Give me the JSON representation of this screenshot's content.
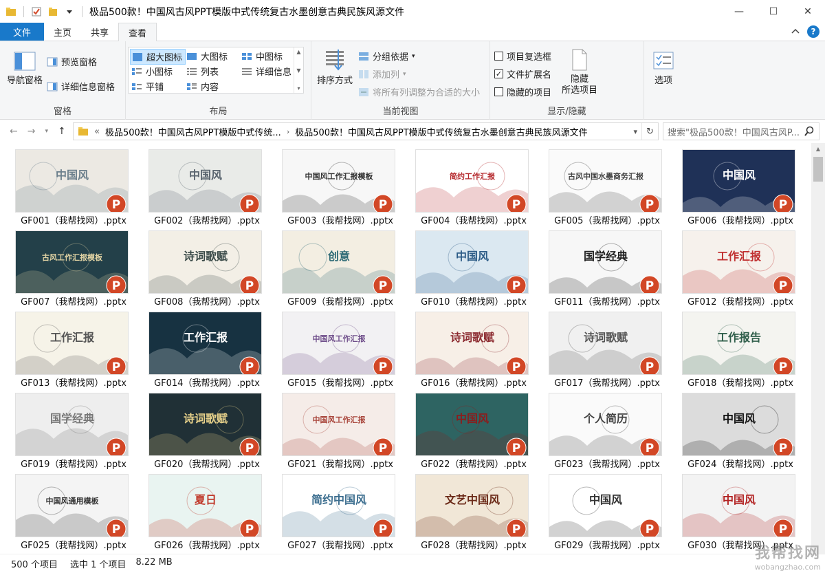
{
  "window": {
    "title": "极品500款！中国风古风PPT模版中式传统复古水墨创意古典民族风源文件",
    "controls": [
      "—",
      "☐",
      "✕"
    ]
  },
  "tabs": [
    {
      "label": "文件"
    },
    {
      "label": "主页"
    },
    {
      "label": "共享"
    },
    {
      "label": "查看"
    }
  ],
  "ribbon": {
    "panes": {
      "label": "窗格",
      "nav_pane": "导航窗格",
      "preview_pane": "预览窗格",
      "details_pane": "详细信息窗格"
    },
    "layout": {
      "label": "布局",
      "options": [
        "超大图标",
        "大图标",
        "中图标",
        "小图标",
        "列表",
        "详细信息",
        "平铺",
        "内容"
      ],
      "selected": "超大图标"
    },
    "current_view": {
      "label": "当前视图",
      "sort_by": "排序方式",
      "group_by": "分组依据",
      "add_column": "添加列",
      "fit_columns": "将所有列调整为合适的大小"
    },
    "show_hide": {
      "label": "显示/隐藏",
      "item_checkboxes": {
        "label": "项目复选框",
        "checked": false
      },
      "file_extensions": {
        "label": "文件扩展名",
        "checked": true
      },
      "hidden_items": {
        "label": "隐藏的项目",
        "checked": false
      },
      "hide_selected_line1": "隐藏",
      "hide_selected_line2": "所选项目"
    },
    "options": "选项"
  },
  "address": {
    "crumb_overflow": "«",
    "crumb1": "极品500款！中国风古风PPT模版中式传统...",
    "crumb2": "极品500款！中国风古风PPT模版中式传统复古水墨创意古典民族风源文件",
    "search_placeholder": "搜索\"极品500款！中国风古风P..."
  },
  "files": [
    {
      "name": "GF001（我帮找网）.pptx",
      "bg": "#ece9e3",
      "accent": "#6b7f8c",
      "title": "中国风"
    },
    {
      "name": "GF002（我帮找网）.pptx",
      "bg": "#e9ebe8",
      "accent": "#5b6670",
      "title": "中国风"
    },
    {
      "name": "GF003（我帮找网）.pptx",
      "bg": "#f7f7f7",
      "accent": "#333333",
      "title": "中国风工作汇报模板"
    },
    {
      "name": "GF004（我帮找网）.pptx",
      "bg": "#ffffff",
      "accent": "#b5282c",
      "title": "简约工作汇报"
    },
    {
      "name": "GF005（我帮找网）.pptx",
      "bg": "#fafafa",
      "accent": "#444444",
      "title": "古风中国水墨商务汇报"
    },
    {
      "name": "GF006（我帮找网）.pptx",
      "bg": "#1f3157",
      "accent": "#ffffff",
      "title": "中国风"
    },
    {
      "name": "GF007（我帮找网）.pptx",
      "bg": "#234049",
      "accent": "#e0d2a3",
      "title": "古风工作汇报模板"
    },
    {
      "name": "GF008（我帮找网）.pptx",
      "bg": "#f3efe6",
      "accent": "#3a4a48",
      "title": "诗词歌赋"
    },
    {
      "name": "GF009（我帮找网）.pptx",
      "bg": "#f3eee2",
      "accent": "#2f6b76",
      "title": "创意"
    },
    {
      "name": "GF010（我帮找网）.pptx",
      "bg": "#dbe8f1",
      "accent": "#2e5d88",
      "title": "中国风"
    },
    {
      "name": "GF011（我帮找网）.pptx",
      "bg": "#f7f7f7",
      "accent": "#222222",
      "title": "国学经典"
    },
    {
      "name": "GF012（我帮找网）.pptx",
      "bg": "#f6f1ec",
      "accent": "#c03030",
      "title": "工作汇报"
    },
    {
      "name": "GF013（我帮找网）.pptx",
      "bg": "#f6f3e8",
      "accent": "#555555",
      "title": "工作汇报"
    },
    {
      "name": "GF014（我帮找网）.pptx",
      "bg": "#173241",
      "accent": "#ffffff",
      "title": "工作汇报"
    },
    {
      "name": "GF015（我帮找网）.pptx",
      "bg": "#f2f1f3",
      "accent": "#6f4e8a",
      "title": "中国风工作汇报"
    },
    {
      "name": "GF016（我帮找网）.pptx",
      "bg": "#f7efe7",
      "accent": "#8c2a30",
      "title": "诗词歌赋"
    },
    {
      "name": "GF017（我帮找网）.pptx",
      "bg": "#f0f0f0",
      "accent": "#555555",
      "title": "诗词歌赋"
    },
    {
      "name": "GF018（我帮找网）.pptx",
      "bg": "#f4f4f0",
      "accent": "#2f5e4a",
      "title": "工作报告"
    },
    {
      "name": "GF019（我帮找网）.pptx",
      "bg": "#eeeeee",
      "accent": "#777777",
      "title": "国学经典"
    },
    {
      "name": "GF020（我帮找网）.pptx",
      "bg": "#203036",
      "accent": "#e6d08a",
      "title": "诗词歌赋"
    },
    {
      "name": "GF021（我帮找网）.pptx",
      "bg": "#f5ece8",
      "accent": "#a8443a",
      "title": "中国风工作汇报"
    },
    {
      "name": "GF022（我帮找网）.pptx",
      "bg": "#2e6462",
      "accent": "#8c1c1c",
      "title": "中国风"
    },
    {
      "name": "GF023（我帮找网）.pptx",
      "bg": "#fafafa",
      "accent": "#444444",
      "title": "个人简历"
    },
    {
      "name": "GF024（我帮找网）.pptx",
      "bg": "#dcdcdc",
      "accent": "#111111",
      "title": "中国风"
    },
    {
      "name": "GF025（我帮找网）.pptx",
      "bg": "#f4f4f4",
      "accent": "#333333",
      "title": "中国风通用模板"
    },
    {
      "name": "GF026（我帮找网）.pptx",
      "bg": "#e9f4f1",
      "accent": "#c0392b",
      "title": "夏日"
    },
    {
      "name": "GF027（我帮找网）.pptx",
      "bg": "#ffffff",
      "accent": "#3c6e8f",
      "title": "简约中国风"
    },
    {
      "name": "GF028（我帮找网）.pptx",
      "bg": "#f1e7d7",
      "accent": "#6b2a18",
      "title": "文艺中国风"
    },
    {
      "name": "GF029（我帮找网）.pptx",
      "bg": "#ffffff",
      "accent": "#333333",
      "title": "中国风"
    },
    {
      "name": "GF030（我帮找网）.pptx",
      "bg": "#f3f3f3",
      "accent": "#b22222",
      "title": "中国风"
    }
  ],
  "status": {
    "count": "500 个项目",
    "selected": "选中 1 个项目",
    "size": "8.22 MB"
  },
  "watermark": {
    "line1": "我帮找网",
    "line2": "wobangzhao.com"
  },
  "colors": {
    "accent": "#1979ca",
    "ppt_orange": "#d24726"
  }
}
